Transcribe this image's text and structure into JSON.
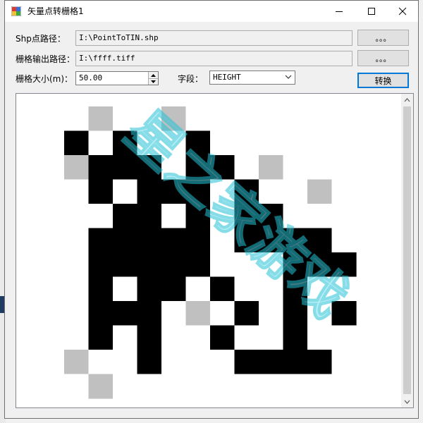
{
  "window": {
    "title": "矢量点转栅格1"
  },
  "form": {
    "shp_label": "Shp点路径：",
    "shp_path": "I:\\PointToTIN.shp",
    "output_label": "栅格输出路径：",
    "output_path": "I:\\ffff.tiff",
    "browse_label": "。。。",
    "cellsize_label": "栅格大小(m)：",
    "cellsize_value": "50.00",
    "field_label": "字段：",
    "field_value": "HEIGHT",
    "convert_label": "转换"
  },
  "raster": {
    "cols": 12,
    "rows": 12,
    "legend": {
      "0": "#ffffff",
      "1": "#000000",
      "2": "#c0c0c0"
    },
    "cells": [
      "020020000000",
      "101001000000",
      "211101102000",
      "010111010020",
      "001101011000",
      "011111011110",
      "011111000111",
      "010110100100",
      "011102010101",
      "010100100100",
      "200100011110",
      "020000000000"
    ]
  },
  "watermark": {
    "text": "星之家游戏"
  }
}
